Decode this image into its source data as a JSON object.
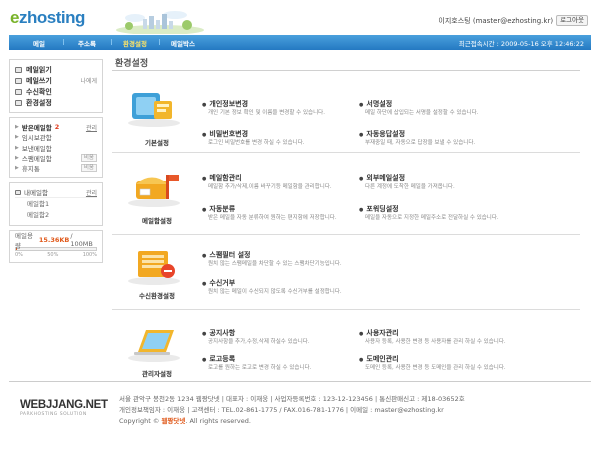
{
  "header": {
    "logo_prefix": "e",
    "logo_rest": "zhosting",
    "user_text": "이지호스팅 (master@ezhosting.kr)",
    "logout_label": "로그아웃"
  },
  "nav": {
    "items": [
      "메일",
      "주소록",
      "환경설정",
      "메일박스"
    ],
    "active_index": 2,
    "last_login": "최근접속시간 : 2009-05-16 오후 12:46:22"
  },
  "sidebar": {
    "main": [
      {
        "label": "메일읽기",
        "link": ""
      },
      {
        "label": "메일쓰기",
        "link": "나에게"
      },
      {
        "label": "수신확인",
        "link": ""
      },
      {
        "label": "환경설정",
        "link": ""
      }
    ],
    "folders": [
      {
        "label": "받은메일함",
        "count": "2",
        "action": "관리"
      },
      {
        "label": "임시보관함",
        "count": "",
        "action": ""
      },
      {
        "label": "보낸메일함",
        "count": "",
        "action": ""
      },
      {
        "label": "스팸메일함",
        "count": "",
        "action": "비움"
      },
      {
        "label": "휴지통",
        "count": "",
        "action": "비움"
      }
    ],
    "mybox": {
      "label": "내메일함",
      "action": "관리",
      "items": [
        "메일함1",
        "메일함2"
      ]
    },
    "usage": {
      "label": "메일용량",
      "used": "15.36KB",
      "total": "/ 100MB",
      "percent": 1,
      "scale": [
        "0%",
        "50%",
        "100%"
      ]
    }
  },
  "main": {
    "title": "환경설정",
    "sections": [
      {
        "label": "기본설정",
        "items": [
          {
            "title": "개인정보변경",
            "desc": "개인 기본 정보 확인 및 이름을 변경할 수 있습니다."
          },
          {
            "title": "서명설정",
            "desc": "메일 하단에 삽입되는 서명을 설정할 수 있습니다."
          },
          {
            "title": "비밀번호변경",
            "desc": "로그인 비밀번호를 변경 하실 수 있습니다."
          },
          {
            "title": "자동응답설정",
            "desc": "부재중일 때, 자동으로 답장을 보낼 수 있습니다."
          }
        ]
      },
      {
        "label": "메일함설정",
        "items": [
          {
            "title": "메일함관리",
            "desc": "메일함 추가/삭제,이름 바꾸기등 메일함을 관리합니다."
          },
          {
            "title": "외부메일설정",
            "desc": "다른 계정에 도착한 메일을 가져옵니다."
          },
          {
            "title": "자동분류",
            "desc": "받은 메일을 자동 분류하여 원하는 편지함에 저장합니다."
          },
          {
            "title": "포워딩설정",
            "desc": "메일을 자동으로 지정한 메일주소로 전달하실 수 있습니다."
          }
        ]
      },
      {
        "label": "수신환경설정",
        "items": [
          {
            "title": "스팸필터 설정",
            "desc": "원치 않는 스팸메일을 차단할 수 있는 스팸차단기능입니다."
          },
          {
            "title": "수신거부",
            "desc": "원치 않는 메일이 수신되지 않도록 수신거부를 설정합니다."
          }
        ]
      },
      {
        "label": "관리자설정",
        "items": [
          {
            "title": "공지사항",
            "desc": "공지사항을 추가,수정,삭제 하실수 있습니다."
          },
          {
            "title": "사용자관리",
            "desc": "사용자 등록, 사용한 변경 등 사용자를 관리 하실 수 있습니다."
          },
          {
            "title": "로고등록",
            "desc": "로고를 원하는 로고로 변경 하실 수 있습니다."
          },
          {
            "title": "도메인관리",
            "desc": "도메인 등록, 사용한 변경 등 도메인을 관리 하실 수 있습니다."
          }
        ]
      }
    ]
  },
  "footer": {
    "logo": "WEBJJANG.NET",
    "logo_sub": "PARKHOSTING SOLUTION",
    "line1": "서울 관악구 봉천2동 1234   웹짱닷넷   |   대표자 : 이재웅   |   사업자등록번호 : 123-12-123456   |   통신판매신고 : 제18-03652호",
    "line2": "개인정보책임자 : 이재웅   |   고객센터 : TEL.02-861-1775 / FAX.016-781-1776   |   이메일 : master@ezhosting.kr",
    "copy_prefix": "Copyright ©",
    "copy_brand": "웹짱닷넷",
    "copy_suffix": ". All rights reserved."
  },
  "colors": {
    "nav_blue": "#2479c2",
    "active_nav": "#ffe566",
    "accent_orange": "#e05a1c",
    "count_red": "#e03c1f"
  }
}
